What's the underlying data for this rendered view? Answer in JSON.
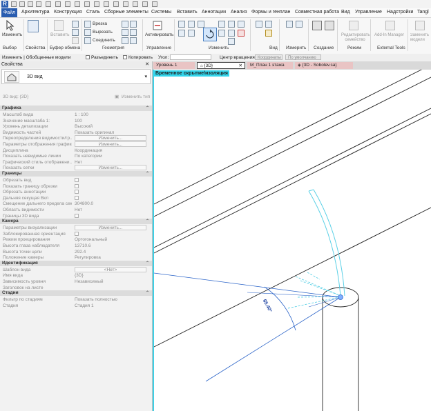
{
  "app": {
    "logo": "R"
  },
  "menu": {
    "file": "Файл",
    "items": [
      "Архитектура",
      "Конструкция",
      "Сталь",
      "Сборные элементы",
      "Системы",
      "Вставить",
      "Аннотации",
      "Анализ",
      "Формы и генплан",
      "Совместная работа",
      "Вид",
      "Управление",
      "Надстройки",
      "Tangl"
    ]
  },
  "ribbon": {
    "modify": "Изменить",
    "paste": "Вставить",
    "cut_copy": {
      "slice": "Врезка",
      "cut": "Вырезать",
      "join": "Соединить"
    },
    "activate": "Активировать",
    "edit_family": "Редактировать семейство",
    "addin_manager": "Add-In Manager",
    "replace": "Заменить модели",
    "groups": {
      "select": "Выбор",
      "properties": "Свойства",
      "clipboard": "Буфер обмена",
      "geometry": "Геометрия",
      "controls": "Управление",
      "modify": "Изменить",
      "view": "Вид",
      "measure": "Измерить",
      "create": "Создание",
      "mode": "Режим",
      "external": "External Tools"
    }
  },
  "options_bar": {
    "context": "Изменить | Обобщенные модели",
    "disjoin": "Разъединить",
    "copy": "Копировать",
    "angle": "Угол:",
    "rotation_center": "Центр вращения:",
    "coords": "Координаты",
    "default": "По умолчанию"
  },
  "properties": {
    "header": "Свойства",
    "type_name": "3D вид",
    "view_selector": "3D вид: {3D}",
    "edit_type": "Изменить тип",
    "sections": [
      {
        "title": "Графика",
        "rows": [
          {
            "k": "Масштаб вида",
            "v": "1 : 100",
            "kind": "text"
          },
          {
            "k": "Значение масштаба    1:",
            "v": "100",
            "kind": "text"
          },
          {
            "k": "Уровень детализации",
            "v": "Высокий",
            "kind": "text"
          },
          {
            "k": "Видимость частей",
            "v": "Показать оригинал",
            "kind": "text"
          },
          {
            "k": "Переопределения видимости/гр...",
            "v": "Изменить...",
            "kind": "button"
          },
          {
            "k": "Параметры отображения графики",
            "v": "Изменить...",
            "kind": "button"
          },
          {
            "k": "Дисциплина",
            "v": "Координация",
            "kind": "text"
          },
          {
            "k": "Показать невидимые линии",
            "v": "По категории",
            "kind": "text"
          },
          {
            "k": "Графический стиль отображени...",
            "v": "Нет",
            "kind": "text"
          },
          {
            "k": "Показать сетки",
            "v": "Изменить...",
            "kind": "button"
          }
        ]
      },
      {
        "title": "Границы",
        "rows": [
          {
            "k": "Обрезать вид",
            "v": "",
            "kind": "check"
          },
          {
            "k": "Показать границу обрезки",
            "v": "",
            "kind": "check"
          },
          {
            "k": "Обрезать аннотации",
            "v": "",
            "kind": "check"
          },
          {
            "k": "Дальняя секущая Вкл",
            "v": "",
            "kind": "check"
          },
          {
            "k": "Смещение дальнего предела сек...",
            "v": "304800.0",
            "kind": "text"
          },
          {
            "k": "Область видимости",
            "v": "Нет",
            "kind": "text"
          },
          {
            "k": "Границы 3D вида",
            "v": "",
            "kind": "check"
          }
        ]
      },
      {
        "title": "Камера",
        "rows": [
          {
            "k": "Параметры визуализации",
            "v": "Изменить...",
            "kind": "button"
          },
          {
            "k": "Заблокированная ориентация",
            "v": "",
            "kind": "check"
          },
          {
            "k": "Режим проецирования",
            "v": "Ортогональный",
            "kind": "text"
          },
          {
            "k": "Высота глаза наблюдателя",
            "v": "13710.6",
            "kind": "text"
          },
          {
            "k": "Высота точки цели",
            "v": "292.4",
            "kind": "text"
          },
          {
            "k": "Положение камеры",
            "v": "Регулировка",
            "kind": "text"
          }
        ]
      },
      {
        "title": "Идентификация",
        "rows": [
          {
            "k": "Шаблон вида",
            "v": "<Нет>",
            "kind": "button"
          },
          {
            "k": "Имя вида",
            "v": "{3D}",
            "kind": "text"
          },
          {
            "k": "Зависимость уровня",
            "v": "Независимый",
            "kind": "text"
          },
          {
            "k": "Заголовок на листе",
            "v": "",
            "kind": "text"
          }
        ]
      },
      {
        "title": "Стадии",
        "rows": [
          {
            "k": "Фильтр по стадиям",
            "v": "Показать полностью",
            "kind": "text"
          },
          {
            "k": "Стадия",
            "v": "Стадия 1",
            "kind": "text"
          }
        ]
      }
    ]
  },
  "view_tabs": [
    {
      "label": "Уровень 1"
    },
    {
      "label": "{3D}"
    },
    {
      "label": "M_План 1 этажа"
    },
    {
      "label": "{3D - Sobolev.sa}"
    }
  ],
  "canvas": {
    "temp_hide": "Временное скрытие/изоляция",
    "angle_label": "65.40°"
  },
  "colors": {
    "accent": "#2a5db0",
    "highlight": "#33d6ec",
    "tab_pink": "#e9c4c4"
  }
}
